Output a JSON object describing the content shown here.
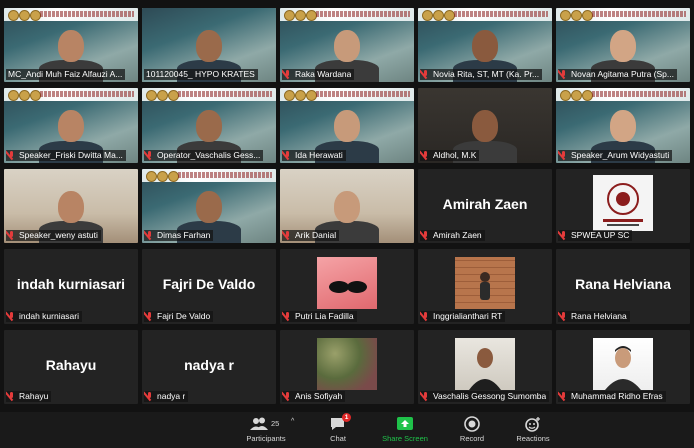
{
  "meeting": {
    "tiles": [
      {
        "name": "MC_Andi Muh Faiz Alfauzi A...",
        "kind": "video",
        "bg": "blue",
        "banner": true,
        "muted": false
      },
      {
        "name": "101120045_ HYPO KRATES",
        "kind": "video",
        "bg": "blue",
        "banner": false,
        "muted": false,
        "active": true
      },
      {
        "name": "Raka Wardana",
        "kind": "video",
        "bg": "blue",
        "banner": true,
        "muted": true
      },
      {
        "name": "Novia Rita, ST, MT (Ka. Pr...",
        "kind": "video",
        "bg": "blue",
        "banner": true,
        "muted": true
      },
      {
        "name": "Novan Agitama Putra (Sp...",
        "kind": "video",
        "bg": "blue",
        "banner": true,
        "muted": true
      },
      {
        "name": "Speaker_Friski Dwitta Ma...",
        "kind": "video",
        "bg": "blue",
        "banner": true,
        "muted": true
      },
      {
        "name": "Operator_Vaschalis Gess...",
        "kind": "video",
        "bg": "blue",
        "banner": true,
        "muted": true
      },
      {
        "name": "Ida Herawati",
        "kind": "video",
        "bg": "blue",
        "banner": true,
        "muted": true
      },
      {
        "name": "Aldhol, M.K",
        "kind": "video",
        "bg": "dark",
        "banner": false,
        "muted": true
      },
      {
        "name": "Speaker_Arum Widyastuti",
        "kind": "video",
        "bg": "blue",
        "banner": true,
        "muted": true
      },
      {
        "name": "Speaker_weny astuti",
        "kind": "video",
        "bg": "room",
        "banner": false,
        "muted": true
      },
      {
        "name": "Dimas Farhan",
        "kind": "video",
        "bg": "blue",
        "banner": true,
        "muted": true
      },
      {
        "name": "Arik Danial",
        "kind": "video",
        "bg": "room",
        "banner": false,
        "muted": true
      },
      {
        "name": "Amirah Zaen",
        "kind": "name",
        "display": "Amirah Zaen",
        "muted": true
      },
      {
        "name": "SPWEA UP SC",
        "kind": "thumb",
        "thumb": "logo",
        "muted": true
      },
      {
        "name": "indah kurniasari",
        "kind": "name",
        "display": "indah kurniasari",
        "muted": true
      },
      {
        "name": "Fajri De Valdo",
        "kind": "name",
        "display": "Fajri De Valdo",
        "muted": true
      },
      {
        "name": "Putri Lia Fadilla",
        "kind": "thumb",
        "thumb": "pink",
        "muted": true
      },
      {
        "name": "Inggrialianthari RT",
        "kind": "thumb",
        "thumb": "brick",
        "muted": true
      },
      {
        "name": "Rana Helviana",
        "kind": "name",
        "display": "Rana Helviana",
        "muted": true
      },
      {
        "name": "Rahayu",
        "kind": "name",
        "display": "Rahayu",
        "muted": true
      },
      {
        "name": "nadya r",
        "kind": "name",
        "display": "nadya r",
        "muted": true
      },
      {
        "name": "Anis Sofiyah",
        "kind": "thumb",
        "thumb": "leaves",
        "muted": true
      },
      {
        "name": "Vaschalis Gessong Sumomba",
        "kind": "thumb",
        "thumb": "portrait",
        "muted": true
      },
      {
        "name": "Muhammad Ridho Efras",
        "kind": "thumb",
        "thumb": "portrait2",
        "muted": true
      }
    ]
  },
  "toolbar": {
    "participants_label": "Participants",
    "participants_count": "25",
    "chat_label": "Chat",
    "chat_badge": "1",
    "share_label": "Share Screen",
    "record_label": "Record",
    "reactions_label": "Reactions"
  },
  "colors": {
    "share_green": "#1fc24a",
    "muted_red": "#e43b3b",
    "active_outline": "#e9e49a"
  }
}
